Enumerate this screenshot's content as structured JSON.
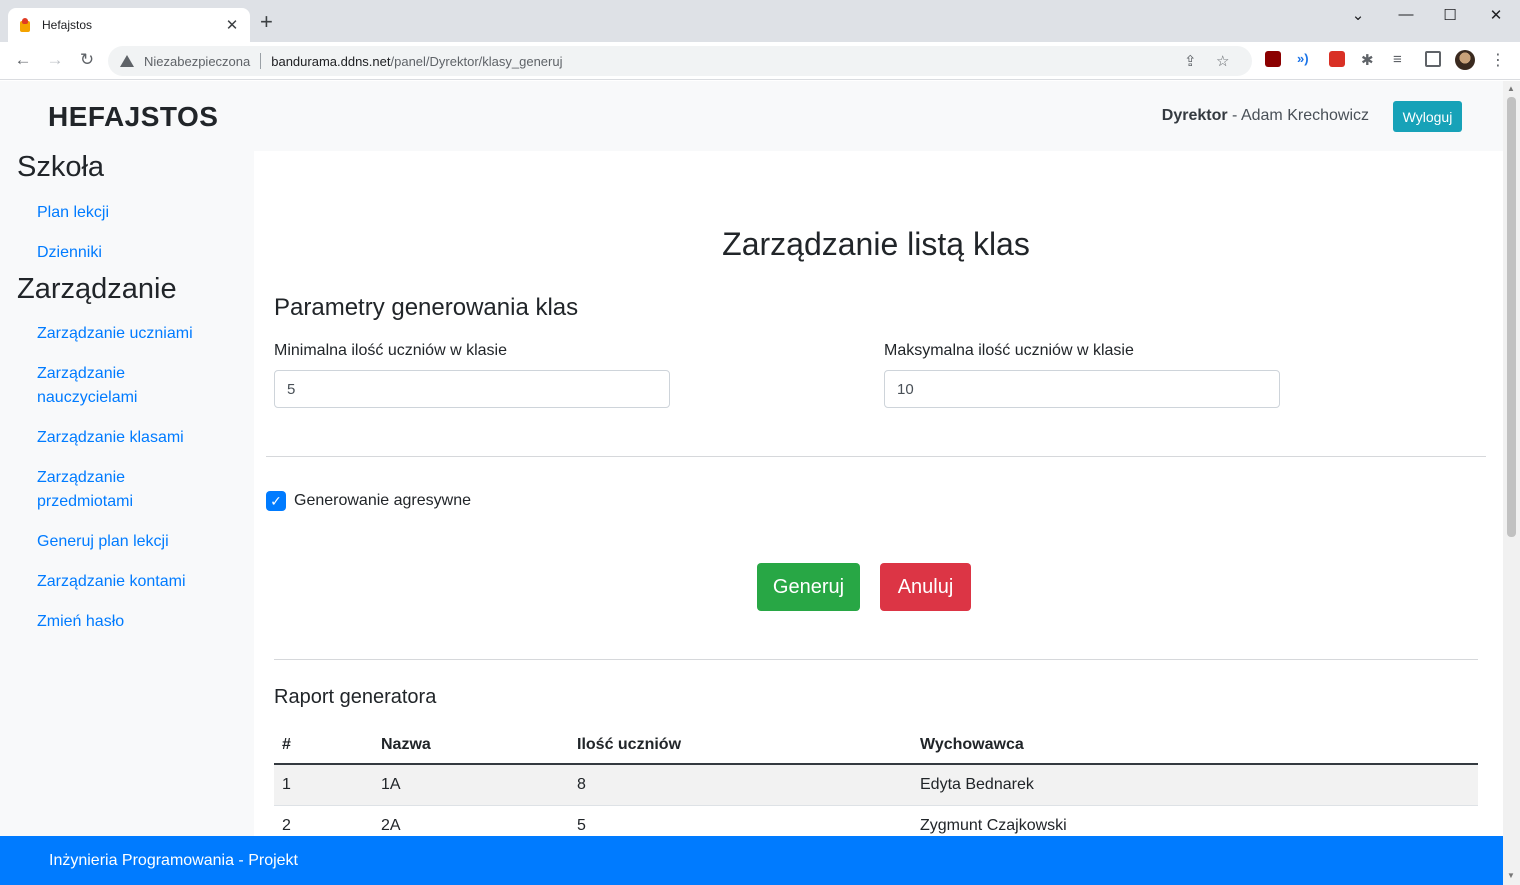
{
  "browser": {
    "tab_title": "Hefajstos",
    "tab_close": "✕",
    "new_tab": "+",
    "insecure_label": "Niezabezpieczona",
    "url_host": "bandurama.ddns.net",
    "url_path": "/panel/Dyrektor/klasy_generuj"
  },
  "header": {
    "brand": "HEFAJSTOS",
    "role": "Dyrektor",
    "user_name": "Adam Krechowicz",
    "logout_label": "Wyloguj"
  },
  "sidebar": {
    "school_heading": "Szkoła",
    "school_links": [
      "Plan lekcji",
      "Dzienniki"
    ],
    "manage_heading": "Zarządzanie",
    "manage_links": [
      "Zarządzanie uczniami",
      "Zarządzanie nauczycielami",
      "Zarządzanie klasami",
      "Zarządzanie przedmiotami",
      "Generuj plan lekcji",
      "Zarządzanie kontami",
      "Zmień hasło"
    ]
  },
  "main": {
    "page_title": "Zarządzanie listą klas",
    "section_title": "Parametry generowania klas",
    "min_label": "Minimalna ilość uczniów w klasie",
    "min_value": "5",
    "max_label": "Maksymalna ilość uczniów w klasie",
    "max_value": "10",
    "aggressive_label": "Generowanie agresywne",
    "aggressive_checked": true,
    "generate_button": "Generuj",
    "cancel_button": "Anuluj",
    "report_title": "Raport generatora",
    "table": {
      "headers": [
        "#",
        "Nazwa",
        "Ilość uczniów",
        "Wychowawca"
      ],
      "rows": [
        [
          "1",
          "1A",
          "8",
          "Edyta Bednarek"
        ],
        [
          "2",
          "2A",
          "5",
          "Zygmunt Czajkowski"
        ]
      ]
    }
  },
  "footer": {
    "text": "Inżynieria Programowania - Projekt"
  },
  "colors": {
    "primary": "#007bff",
    "success": "#28a745",
    "danger": "#dc3545",
    "info": "#17a2b8"
  }
}
